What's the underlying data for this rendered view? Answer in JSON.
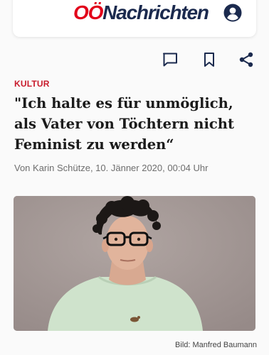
{
  "header": {
    "logo_part1": "OÖ",
    "logo_part2": "Nachrichten",
    "account_icon": "account-icon"
  },
  "actions": {
    "comment_icon": "comment-icon",
    "bookmark_icon": "bookmark-icon",
    "share_icon": "share-icon"
  },
  "article": {
    "category": "KULTUR",
    "headline": "\"Ich halte es für unmöglich, als Vater von Töchtern nicht Feminist zu werden“",
    "byline": "Von Karin Schütze, 10. Jänner 2020, 00:04 Uhr",
    "photo_credit": "Bild: Manfred Baumann"
  },
  "colors": {
    "accent_red": "#c81a2b",
    "brand_navy": "#1b2a4e",
    "icon_blue": "#1b2a4e"
  }
}
